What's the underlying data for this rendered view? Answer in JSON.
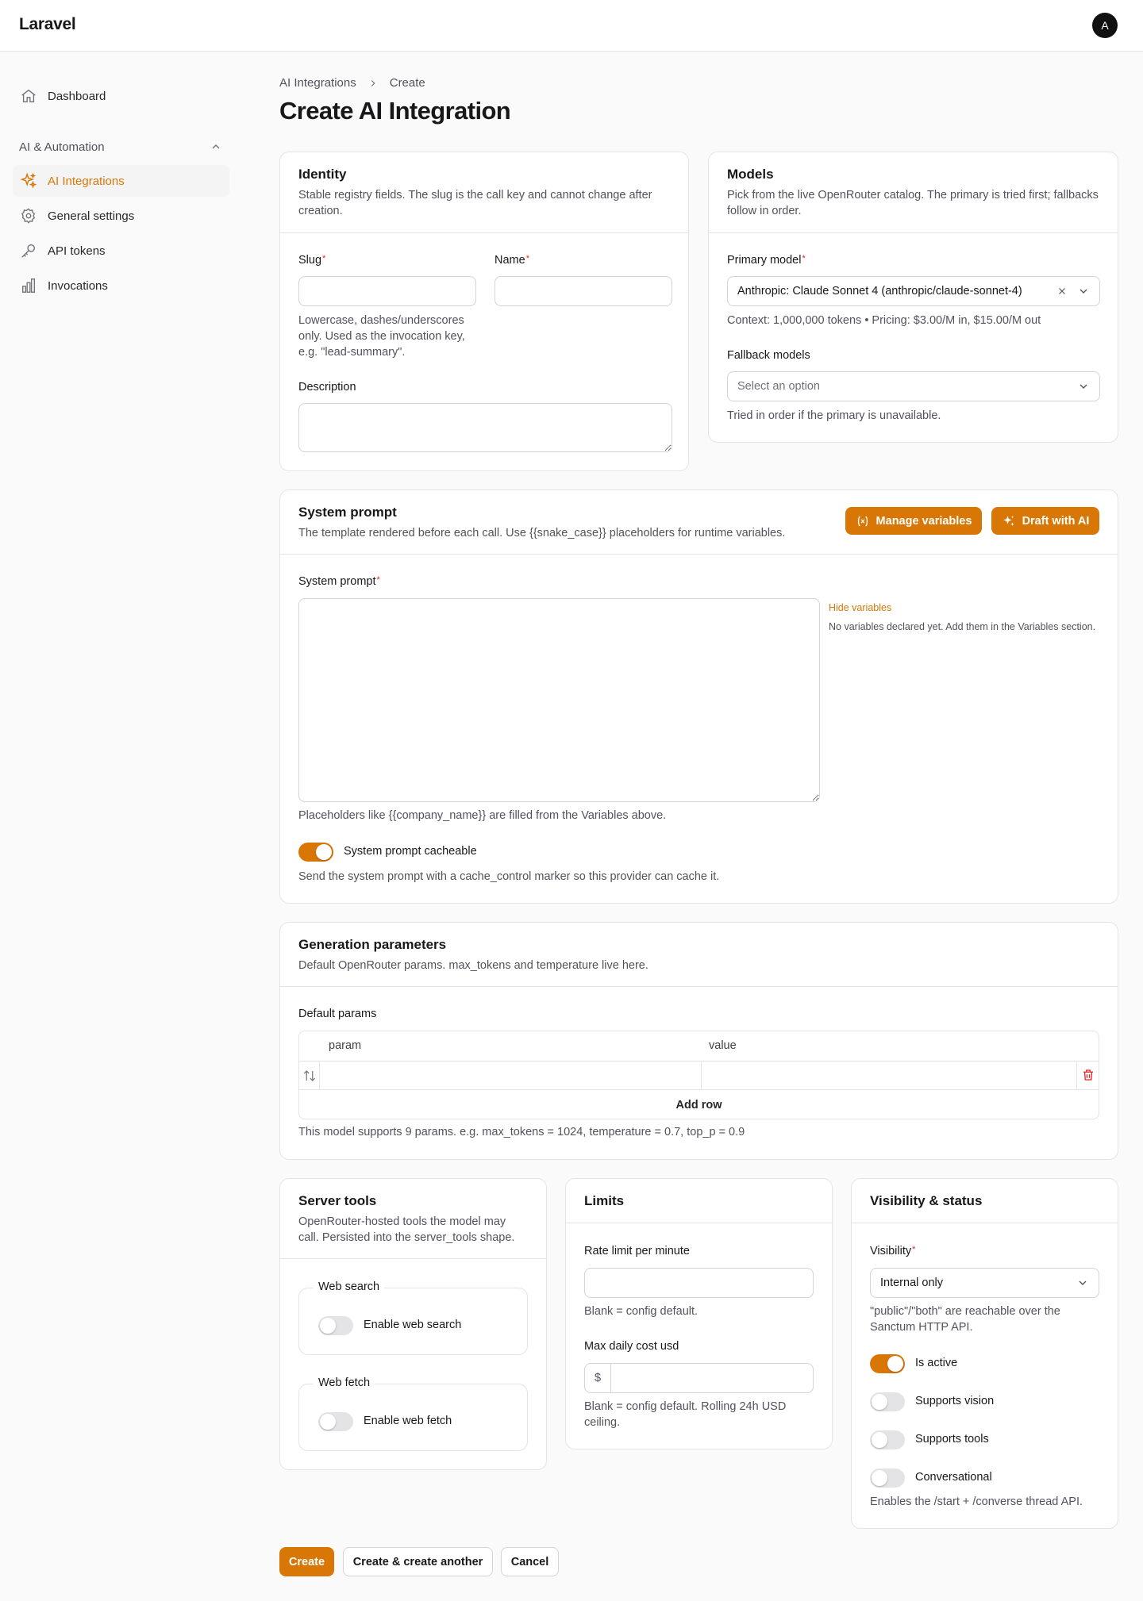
{
  "app": {
    "brand": "Laravel",
    "avatar_initial": "A",
    "accent_color": "#d97706"
  },
  "sidebar": {
    "dashboard": {
      "label": "Dashboard",
      "icon": "home-icon"
    },
    "group": {
      "label": "AI & Automation",
      "icon": "chevron-up-icon"
    },
    "items": [
      {
        "label": "AI Integrations",
        "icon": "sparkles-icon",
        "active": true
      },
      {
        "label": "General settings",
        "icon": "gear-icon",
        "active": false
      },
      {
        "label": "API tokens",
        "icon": "key-icon",
        "active": false
      },
      {
        "label": "Invocations",
        "icon": "bar-chart-icon",
        "active": false
      }
    ]
  },
  "breadcrumb": {
    "parent": "AI Integrations",
    "current": "Create"
  },
  "page": {
    "title": "Create AI Integration"
  },
  "identity": {
    "title": "Identity",
    "desc": "Stable registry fields. The slug is the call key and cannot change after creation.",
    "slug": {
      "label": "Slug",
      "value": "",
      "hint": "Lowercase, dashes/underscores only. Used as the invocation key, e.g. \"lead-summary\"."
    },
    "name": {
      "label": "Name",
      "value": ""
    },
    "description": {
      "label": "Description",
      "value": ""
    }
  },
  "models": {
    "title": "Models",
    "desc": "Pick from the live OpenRouter catalog. The primary is tried first; fallbacks follow in order.",
    "primary": {
      "label": "Primary model",
      "value": "Anthropic: Claude Sonnet 4 (anthropic/claude-sonnet-4)",
      "hint": "Context: 1,000,000 tokens • Pricing: $3.00/M in, $15.00/M out"
    },
    "fallback": {
      "label": "Fallback models",
      "placeholder": "Select an option",
      "hint": "Tried in order if the primary is unavailable."
    }
  },
  "system_prompt": {
    "title": "System prompt",
    "desc": "The template rendered before each call. Use {{snake_case}} placeholders for runtime variables.",
    "manage_variables_label": "Manage variables",
    "draft_ai_label": "Draft with AI",
    "field_label": "System prompt",
    "value": "",
    "hide_variables_label": "Hide variables",
    "no_variables_text": "No variables declared yet. Add them in the Variables section.",
    "hint": "Placeholders like {{company_name}} are filled from the Variables above.",
    "cacheable": {
      "label": "System prompt cacheable",
      "on": true,
      "hint": "Send the system prompt with a cache_control marker so this provider can cache it."
    }
  },
  "generation": {
    "title": "Generation parameters",
    "desc": "Default OpenRouter params. max_tokens and temperature live here.",
    "label": "Default params",
    "col_param": "param",
    "col_value": "value",
    "add_row_label": "Add row",
    "hint": "This model supports 9 params. e.g. max_tokens = 1024, temperature = 0.7, top_p = 0.9"
  },
  "server_tools": {
    "title": "Server tools",
    "desc": "OpenRouter-hosted tools the model may call. Persisted into the server_tools shape.",
    "web_search": {
      "legend": "Web search",
      "label": "Enable web search",
      "on": false
    },
    "web_fetch": {
      "legend": "Web fetch",
      "label": "Enable web fetch",
      "on": false
    }
  },
  "limits": {
    "title": "Limits",
    "rate": {
      "label": "Rate limit per minute",
      "value": "",
      "hint": "Blank = config default."
    },
    "cost": {
      "label": "Max daily cost usd",
      "prefix": "$",
      "value": "",
      "hint": "Blank = config default. Rolling 24h USD ceiling."
    }
  },
  "visibility": {
    "title": "Visibility & status",
    "label": "Visibility",
    "value": "Internal only",
    "hint": "\"public\"/\"both\" are reachable over the Sanctum HTTP API.",
    "is_active": {
      "label": "Is active",
      "on": true
    },
    "supports_vision": {
      "label": "Supports vision",
      "on": false
    },
    "supports_tools": {
      "label": "Supports tools",
      "on": false
    },
    "conversational": {
      "label": "Conversational",
      "on": false,
      "hint": "Enables the /start + /converse thread API."
    }
  },
  "actions": {
    "create": "Create",
    "create_another": "Create & create another",
    "cancel": "Cancel"
  }
}
